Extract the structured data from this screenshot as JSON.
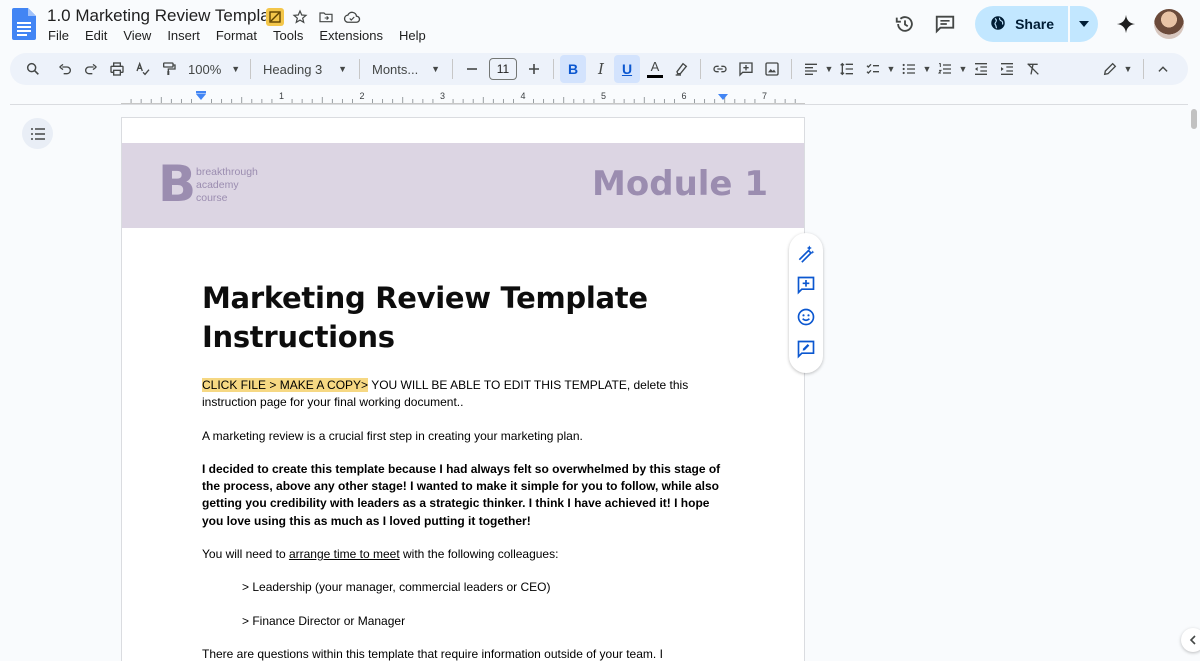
{
  "app": {
    "accent": "#4285f4",
    "share_bg": "#c2e7ff"
  },
  "title": {
    "doc_name": "1.0 Marketing Review Template",
    "icons": [
      "drive-badge-icon",
      "star-icon",
      "move-folder-icon",
      "cloud-saved-icon"
    ]
  },
  "menu": [
    "File",
    "Edit",
    "View",
    "Insert",
    "Format",
    "Tools",
    "Extensions",
    "Help"
  ],
  "header_right": {
    "share_label": "Share",
    "icons": [
      "history-icon",
      "comments-icon",
      "globe-icon",
      "gemini-icon"
    ]
  },
  "toolbar": {
    "zoom": "100%",
    "style": "Heading 3",
    "font": "Monts...",
    "font_size": "11",
    "bold_label": "B",
    "italic_label": "I",
    "underline_label": "U",
    "text_color_label": "A"
  },
  "ruler": {
    "labels": [
      "1",
      "1",
      "2",
      "3",
      "4",
      "5",
      "6",
      "7"
    ]
  },
  "page": {
    "banner": {
      "logo_letter": "B",
      "brand_lines": [
        "breakthrough",
        "academy",
        "course"
      ],
      "module_title": "Module 1",
      "color": "#dcd5e3"
    },
    "heading_line1": "Marketing Review Template",
    "heading_line2": "Instructions",
    "p1_highlight": "CLICK FILE > MAKE A COPY>",
    "p1_rest": " YOU WILL BE ABLE TO EDIT THIS TEMPLATE, delete this instruction page for your final working document..",
    "p2": "A marketing review is a crucial first step in creating your marketing plan.",
    "p3": "I decided to create this template because I had always felt so overwhelmed by this stage of the process, above any other stage! I wanted to make it simple for you to follow, while also getting you credibility with leaders as a strategic thinker. I think I have achieved it! I hope you love using this as much as I loved putting it together!",
    "p4_before": "You will need to ",
    "p4_link": "arrange time to meet",
    "p4_after": " with the following colleagues:",
    "p5": "> Leadership (your manager, commercial leaders or CEO)",
    "p6": "> Finance Director or Manager",
    "p7": "There are questions within this template that require information outside of your team. I recommend"
  }
}
